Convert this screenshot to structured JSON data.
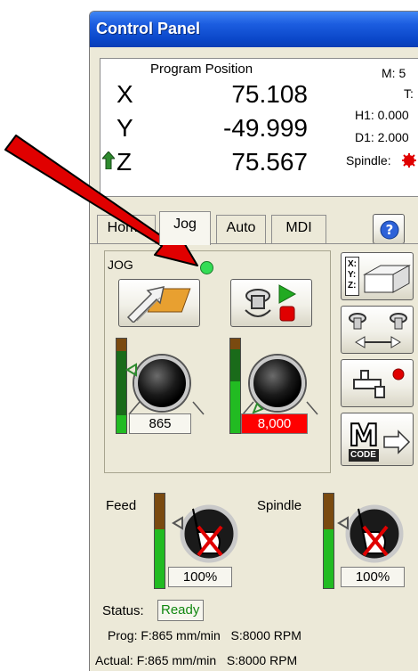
{
  "title": "Control Panel",
  "position": {
    "header": "Program Position",
    "axes": [
      {
        "axis": "X",
        "value": "75.108"
      },
      {
        "axis": "Y",
        "value": "-49.999"
      },
      {
        "axis": "Z",
        "value": "75.567"
      }
    ],
    "m": "M: 5",
    "t": "T:",
    "h1": "H1: 0.000",
    "d1": "D1: 2.000",
    "spindle_label": "Spindle:",
    "spindle_indicator_color": "#e00000"
  },
  "tabs": [
    "Home",
    "Jog",
    "Auto",
    "MDI"
  ],
  "active_tab": "Jog",
  "jog": {
    "label": "JOG",
    "status_light_color": "#33dd55",
    "feed_readout": "865",
    "spindle_readout": "8,000"
  },
  "override": {
    "feed_label": "Feed",
    "spindle_label": "Spindle",
    "feed_value": "100%",
    "spindle_value": "100%"
  },
  "status": {
    "label": "Status:",
    "value": "Ready",
    "prog": "Prog: F:865 mm/min   S:8000 RPM",
    "actual": "Actual: F:865 mm/min   S:8000 RPM"
  },
  "side_buttons": {
    "axis_labels": "X: Y: Z:",
    "mcode_text": "CODE"
  },
  "colors": {
    "title_bar": "#0a46c8",
    "panel_bg": "#ece9d8",
    "status_ready": "#118811",
    "arrow": "#e00000",
    "spindle_readout_bg": "#ff0000"
  }
}
